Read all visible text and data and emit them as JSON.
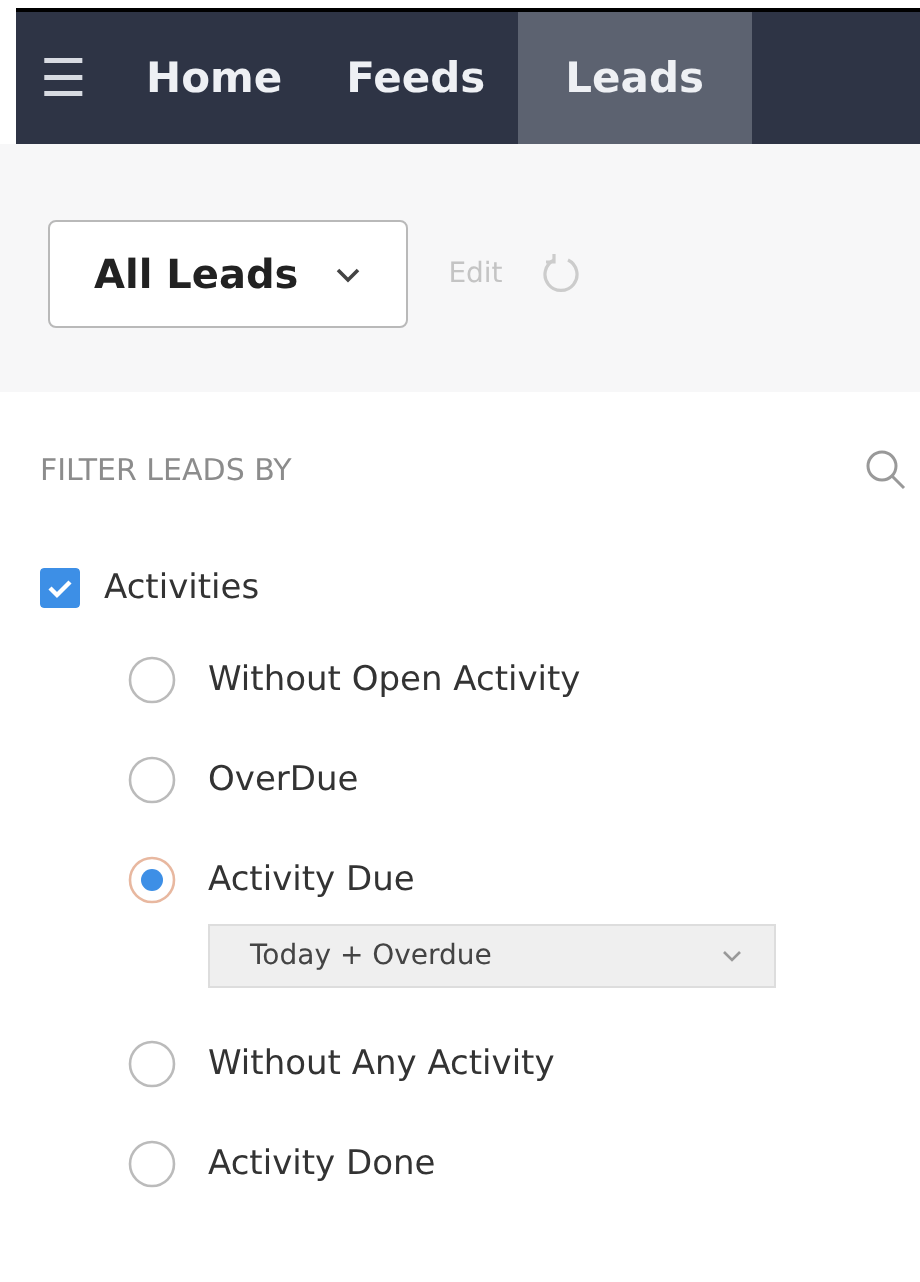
{
  "nav": {
    "menu": "☰",
    "tabs": [
      {
        "label": "Home",
        "selected": false
      },
      {
        "label": "Feeds",
        "selected": false
      },
      {
        "label": "Leads",
        "selected": true
      }
    ]
  },
  "view": {
    "select": "All Leads",
    "edit": "Edit"
  },
  "filter": {
    "title": "FILTER LEADS BY",
    "group": {
      "label": "Activities",
      "checked": true
    },
    "options": [
      {
        "label": "Without Open Activity",
        "selected": false
      },
      {
        "label": "OverDue",
        "selected": false
      },
      {
        "label": "Activity Due",
        "selected": true,
        "range": "Today + Overdue"
      },
      {
        "label": "Without Any Activity",
        "selected": false
      },
      {
        "label": "Activity Done",
        "selected": false
      }
    ]
  }
}
